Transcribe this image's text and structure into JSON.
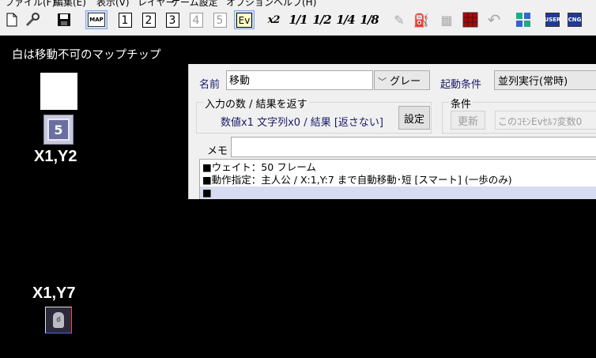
{
  "menubar": [
    "ファイル(F)",
    "編集(E)",
    "表示(V)",
    "レイヤー",
    "ゲーム設定",
    "オプション",
    "ヘルプ(H)"
  ],
  "toolbar": {
    "layer_nums": [
      "1",
      "2",
      "3",
      "4",
      "5"
    ],
    "ev_label": "Ev",
    "zoom_labels": [
      "x2",
      "1/1",
      "1/2",
      "1/4",
      "1/8"
    ],
    "map_label": "MAP",
    "user_label": "USER",
    "cng_label": "CNG"
  },
  "map": {
    "caption": "白は移動不可のマップチップ",
    "coord_1": "X1,Y2",
    "coord_2": "X1,Y7",
    "event_glyph": "5"
  },
  "editor": {
    "name_label": "名前",
    "name_value": "移動",
    "color_value": "グレー",
    "trigger_label": "起動条件",
    "trigger_value": "並列実行(常時)",
    "io_group_title": "入力の数 / 結果を返す",
    "io_summary": "数値x1 文字列x0 / 結果 [返さない]",
    "settings_button": "設定",
    "condition_group_title": "条件",
    "update_button": "更新",
    "condition_value": "このｺﾓﾝEvｾﾙﾌ変数0",
    "memo_label": "メモ",
    "memo_value": "",
    "commands": [
      "■ウェイト：50 フレーム",
      "■動作指定：主人公 /  X:1,Y:7 まで自動移動･短 [スマート] (一歩のみ)",
      "■"
    ]
  }
}
